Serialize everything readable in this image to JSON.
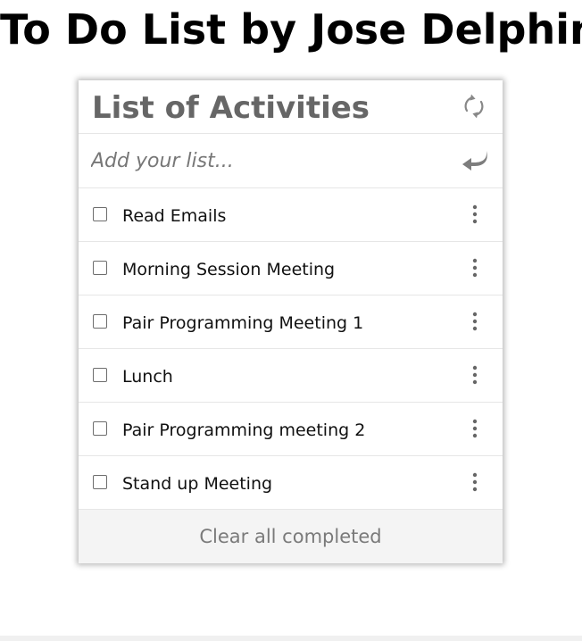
{
  "page": {
    "title": "To Do List by Jose Delphin"
  },
  "card": {
    "title": "List of Activities",
    "refresh_icon": "refresh-icon",
    "input": {
      "placeholder": "Add your list...",
      "value": ""
    },
    "enter_icon": "enter-icon",
    "items": [
      {
        "label": "Read Emails",
        "completed": false
      },
      {
        "label": "Morning Session Meeting",
        "completed": false
      },
      {
        "label": "Pair Programming Meeting 1",
        "completed": false
      },
      {
        "label": "Lunch",
        "completed": false
      },
      {
        "label": "Pair Programming meeting 2",
        "completed": false
      },
      {
        "label": "Stand up Meeting",
        "completed": false
      }
    ],
    "item_menu_icon": "more-vertical-icon",
    "clear_label": "Clear all completed"
  },
  "colors": {
    "title_gray": "#666666",
    "icon_gray": "#777777",
    "divider": "#e6e6e6",
    "footer_bg": "#f4f4f4",
    "footer_text": "#7a7a7a"
  }
}
